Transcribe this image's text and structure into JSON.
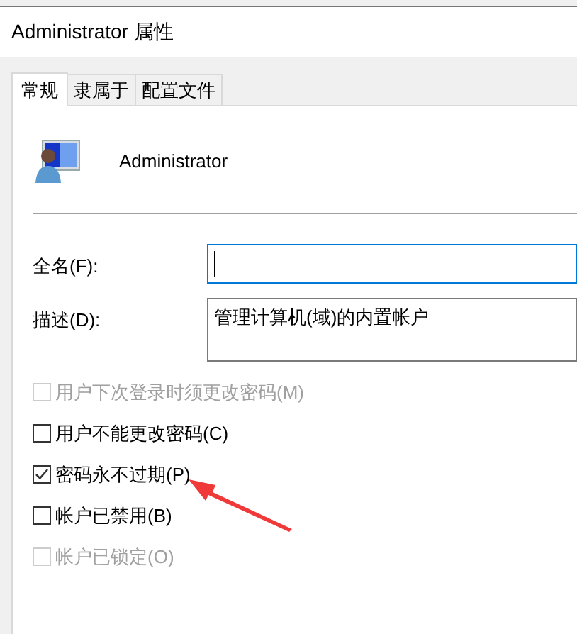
{
  "window": {
    "title": "Administrator 属性"
  },
  "tabs": [
    {
      "label": "常规",
      "selected": true
    },
    {
      "label": "隶属于",
      "selected": false
    },
    {
      "label": "配置文件",
      "selected": false
    }
  ],
  "user": {
    "name": "Administrator"
  },
  "fields": [
    {
      "label": "全名(F):",
      "focused": true,
      "kind": "line"
    },
    {
      "label": "描述(D):",
      "value": "管理计算机(域)的内置帐户",
      "focused": false,
      "kind": "area"
    }
  ],
  "options": [
    {
      "label": "用户下次登录时须更改密码(M)",
      "checked": false,
      "disabled": true
    },
    {
      "label": "用户不能更改密码(C)",
      "checked": false,
      "disabled": false
    },
    {
      "label": "密码永不过期(P)",
      "checked": true,
      "disabled": false
    },
    {
      "label": "帐户已禁用(B)",
      "checked": false,
      "disabled": false
    },
    {
      "label": "帐户已锁定(O)",
      "checked": false,
      "disabled": true
    }
  ]
}
